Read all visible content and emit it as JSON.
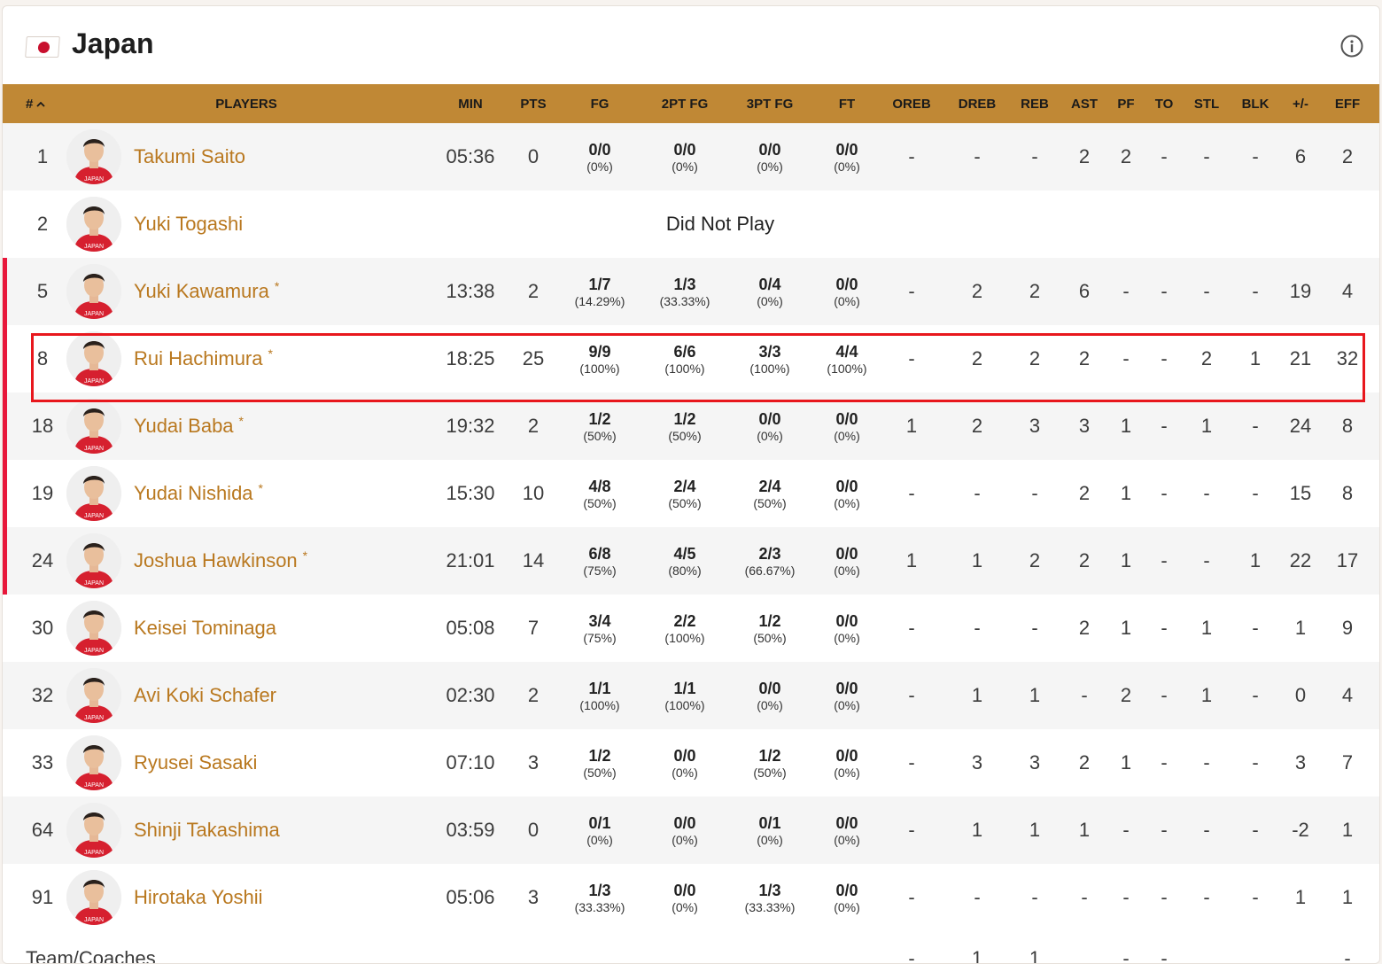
{
  "team": {
    "name": "Japan",
    "flag_icon": "japan-flag-icon",
    "info_icon": "info-icon"
  },
  "columns": [
    "#",
    "PLAYERS",
    "MIN",
    "PTS",
    "FG",
    "2PT FG",
    "3PT FG",
    "FT",
    "OREB",
    "DREB",
    "REB",
    "AST",
    "PF",
    "TO",
    "STL",
    "BLK",
    "+/-",
    "EFF"
  ],
  "players": [
    {
      "num": "1",
      "name": "Takumi Saito",
      "starter": false,
      "dnp": false,
      "min": "05:36",
      "pts": "0",
      "fg": [
        "0/0",
        "(0%)"
      ],
      "fg2": [
        "0/0",
        "(0%)"
      ],
      "fg3": [
        "0/0",
        "(0%)"
      ],
      "ft": [
        "0/0",
        "(0%)"
      ],
      "oreb": "-",
      "dreb": "-",
      "reb": "-",
      "ast": "2",
      "pf": "2",
      "to": "-",
      "stl": "-",
      "blk": "-",
      "pm": "6",
      "eff": "2"
    },
    {
      "num": "2",
      "name": "Yuki Togashi",
      "starter": false,
      "dnp": true,
      "dnp_label": "Did Not Play"
    },
    {
      "num": "5",
      "name": "Yuki Kawamura",
      "starter": true,
      "dnp": false,
      "min": "13:38",
      "pts": "2",
      "fg": [
        "1/7",
        "(14.29%)"
      ],
      "fg2": [
        "1/3",
        "(33.33%)"
      ],
      "fg3": [
        "0/4",
        "(0%)"
      ],
      "ft": [
        "0/0",
        "(0%)"
      ],
      "oreb": "-",
      "dreb": "2",
      "reb": "2",
      "ast": "6",
      "pf": "-",
      "to": "-",
      "stl": "-",
      "blk": "-",
      "pm": "19",
      "eff": "4"
    },
    {
      "num": "8",
      "name": "Rui Hachimura",
      "starter": true,
      "dnp": false,
      "min": "18:25",
      "pts": "25",
      "fg": [
        "9/9",
        "(100%)"
      ],
      "fg2": [
        "6/6",
        "(100%)"
      ],
      "fg3": [
        "3/3",
        "(100%)"
      ],
      "ft": [
        "4/4",
        "(100%)"
      ],
      "oreb": "-",
      "dreb": "2",
      "reb": "2",
      "ast": "2",
      "pf": "-",
      "to": "-",
      "stl": "2",
      "blk": "1",
      "pm": "21",
      "eff": "32"
    },
    {
      "num": "18",
      "name": "Yudai Baba",
      "starter": true,
      "dnp": false,
      "min": "19:32",
      "pts": "2",
      "fg": [
        "1/2",
        "(50%)"
      ],
      "fg2": [
        "1/2",
        "(50%)"
      ],
      "fg3": [
        "0/0",
        "(0%)"
      ],
      "ft": [
        "0/0",
        "(0%)"
      ],
      "oreb": "1",
      "dreb": "2",
      "reb": "3",
      "ast": "3",
      "pf": "1",
      "to": "-",
      "stl": "1",
      "blk": "-",
      "pm": "24",
      "eff": "8"
    },
    {
      "num": "19",
      "name": "Yudai Nishida",
      "starter": true,
      "dnp": false,
      "min": "15:30",
      "pts": "10",
      "fg": [
        "4/8",
        "(50%)"
      ],
      "fg2": [
        "2/4",
        "(50%)"
      ],
      "fg3": [
        "2/4",
        "(50%)"
      ],
      "ft": [
        "0/0",
        "(0%)"
      ],
      "oreb": "-",
      "dreb": "-",
      "reb": "-",
      "ast": "2",
      "pf": "1",
      "to": "-",
      "stl": "-",
      "blk": "-",
      "pm": "15",
      "eff": "8"
    },
    {
      "num": "24",
      "name": "Joshua Hawkinson",
      "starter": true,
      "dnp": false,
      "min": "21:01",
      "pts": "14",
      "fg": [
        "6/8",
        "(75%)"
      ],
      "fg2": [
        "4/5",
        "(80%)"
      ],
      "fg3": [
        "2/3",
        "(66.67%)"
      ],
      "ft": [
        "0/0",
        "(0%)"
      ],
      "oreb": "1",
      "dreb": "1",
      "reb": "2",
      "ast": "2",
      "pf": "1",
      "to": "-",
      "stl": "-",
      "blk": "1",
      "pm": "22",
      "eff": "17"
    },
    {
      "num": "30",
      "name": "Keisei Tominaga",
      "starter": false,
      "dnp": false,
      "min": "05:08",
      "pts": "7",
      "fg": [
        "3/4",
        "(75%)"
      ],
      "fg2": [
        "2/2",
        "(100%)"
      ],
      "fg3": [
        "1/2",
        "(50%)"
      ],
      "ft": [
        "0/0",
        "(0%)"
      ],
      "oreb": "-",
      "dreb": "-",
      "reb": "-",
      "ast": "2",
      "pf": "1",
      "to": "-",
      "stl": "1",
      "blk": "-",
      "pm": "1",
      "eff": "9"
    },
    {
      "num": "32",
      "name": "Avi Koki Schafer",
      "starter": false,
      "dnp": false,
      "min": "02:30",
      "pts": "2",
      "fg": [
        "1/1",
        "(100%)"
      ],
      "fg2": [
        "1/1",
        "(100%)"
      ],
      "fg3": [
        "0/0",
        "(0%)"
      ],
      "ft": [
        "0/0",
        "(0%)"
      ],
      "oreb": "-",
      "dreb": "1",
      "reb": "1",
      "ast": "-",
      "pf": "2",
      "to": "-",
      "stl": "1",
      "blk": "-",
      "pm": "0",
      "eff": "4"
    },
    {
      "num": "33",
      "name": "Ryusei Sasaki",
      "starter": false,
      "dnp": false,
      "min": "07:10",
      "pts": "3",
      "fg": [
        "1/2",
        "(50%)"
      ],
      "fg2": [
        "0/0",
        "(0%)"
      ],
      "fg3": [
        "1/2",
        "(50%)"
      ],
      "ft": [
        "0/0",
        "(0%)"
      ],
      "oreb": "-",
      "dreb": "3",
      "reb": "3",
      "ast": "2",
      "pf": "1",
      "to": "-",
      "stl": "-",
      "blk": "-",
      "pm": "3",
      "eff": "7"
    },
    {
      "num": "64",
      "name": "Shinji Takashima",
      "starter": false,
      "dnp": false,
      "min": "03:59",
      "pts": "0",
      "fg": [
        "0/1",
        "(0%)"
      ],
      "fg2": [
        "0/0",
        "(0%)"
      ],
      "fg3": [
        "0/1",
        "(0%)"
      ],
      "ft": [
        "0/0",
        "(0%)"
      ],
      "oreb": "-",
      "dreb": "1",
      "reb": "1",
      "ast": "1",
      "pf": "-",
      "to": "-",
      "stl": "-",
      "blk": "-",
      "pm": "-2",
      "eff": "1"
    },
    {
      "num": "91",
      "name": "Hirotaka Yoshii",
      "starter": false,
      "dnp": false,
      "min": "05:06",
      "pts": "3",
      "fg": [
        "1/3",
        "(33.33%)"
      ],
      "fg2": [
        "0/0",
        "(0%)"
      ],
      "fg3": [
        "1/3",
        "(33.33%)"
      ],
      "ft": [
        "0/0",
        "(0%)"
      ],
      "oreb": "-",
      "dreb": "-",
      "reb": "-",
      "ast": "-",
      "pf": "-",
      "to": "-",
      "stl": "-",
      "blk": "-",
      "pm": "1",
      "eff": "1"
    }
  ],
  "team_coaches": {
    "label": "Team/Coaches",
    "oreb": "-",
    "dreb": "1",
    "reb": "1",
    "ast": "",
    "pf": "-",
    "to": "-",
    "stl": "",
    "blk": "",
    "pm": "",
    "eff": "-"
  },
  "colors": {
    "header": "#c08835",
    "name": "#b9781f",
    "starter_bar": "#e8173a",
    "highlight": "#e8171d"
  }
}
